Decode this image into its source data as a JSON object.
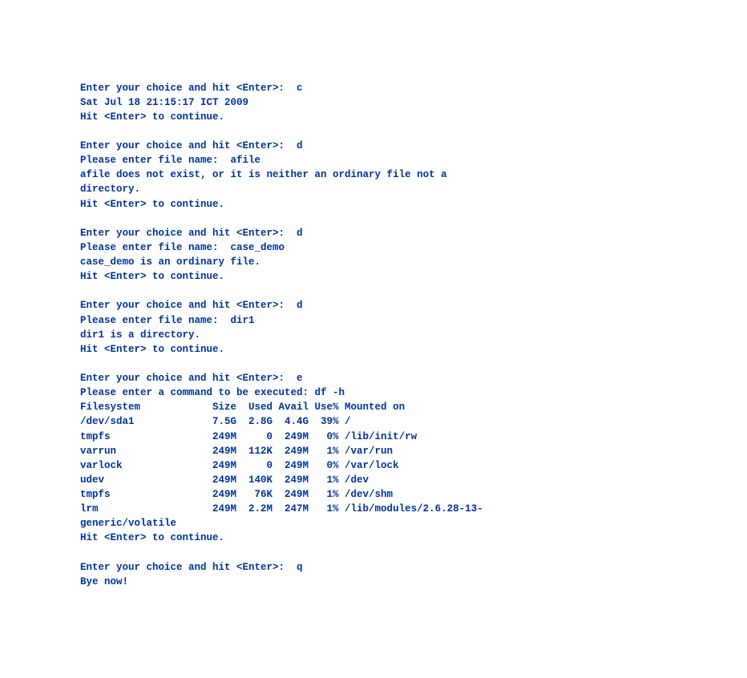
{
  "lines": [
    "Enter your choice and hit <Enter>:  c",
    "Sat Jul 18 21:15:17 ICT 2009",
    "Hit <Enter> to continue.",
    "",
    "Enter your choice and hit <Enter>:  d",
    "Please enter file name:  afile",
    "afile does not exist, or it is neither an ordinary file not a",
    "directory.",
    "Hit <Enter> to continue.",
    "",
    "Enter your choice and hit <Enter>:  d",
    "Please enter file name:  case_demo",
    "case_demo is an ordinary file.",
    "Hit <Enter> to continue.",
    "",
    "Enter your choice and hit <Enter>:  d",
    "Please enter file name:  dir1",
    "dir1 is a directory.",
    "Hit <Enter> to continue.",
    "",
    "Enter your choice and hit <Enter>:  e",
    "Please enter a command to be executed: df -h",
    "Filesystem            Size  Used Avail Use% Mounted on",
    "/dev/sda1             7.5G  2.8G  4.4G  39% /",
    "tmpfs                 249M     0  249M   0% /lib/init/rw",
    "varrun                249M  112K  249M   1% /var/run",
    "varlock               249M     0  249M   0% /var/lock",
    "udev                  249M  140K  249M   1% /dev",
    "tmpfs                 249M   76K  249M   1% /dev/shm",
    "lrm                   249M  2.2M  247M   1% /lib/modules/2.6.28-13-",
    "generic/volatile",
    "Hit <Enter> to continue.",
    "",
    "Enter your choice and hit <Enter>:  q",
    "Bye now!"
  ]
}
